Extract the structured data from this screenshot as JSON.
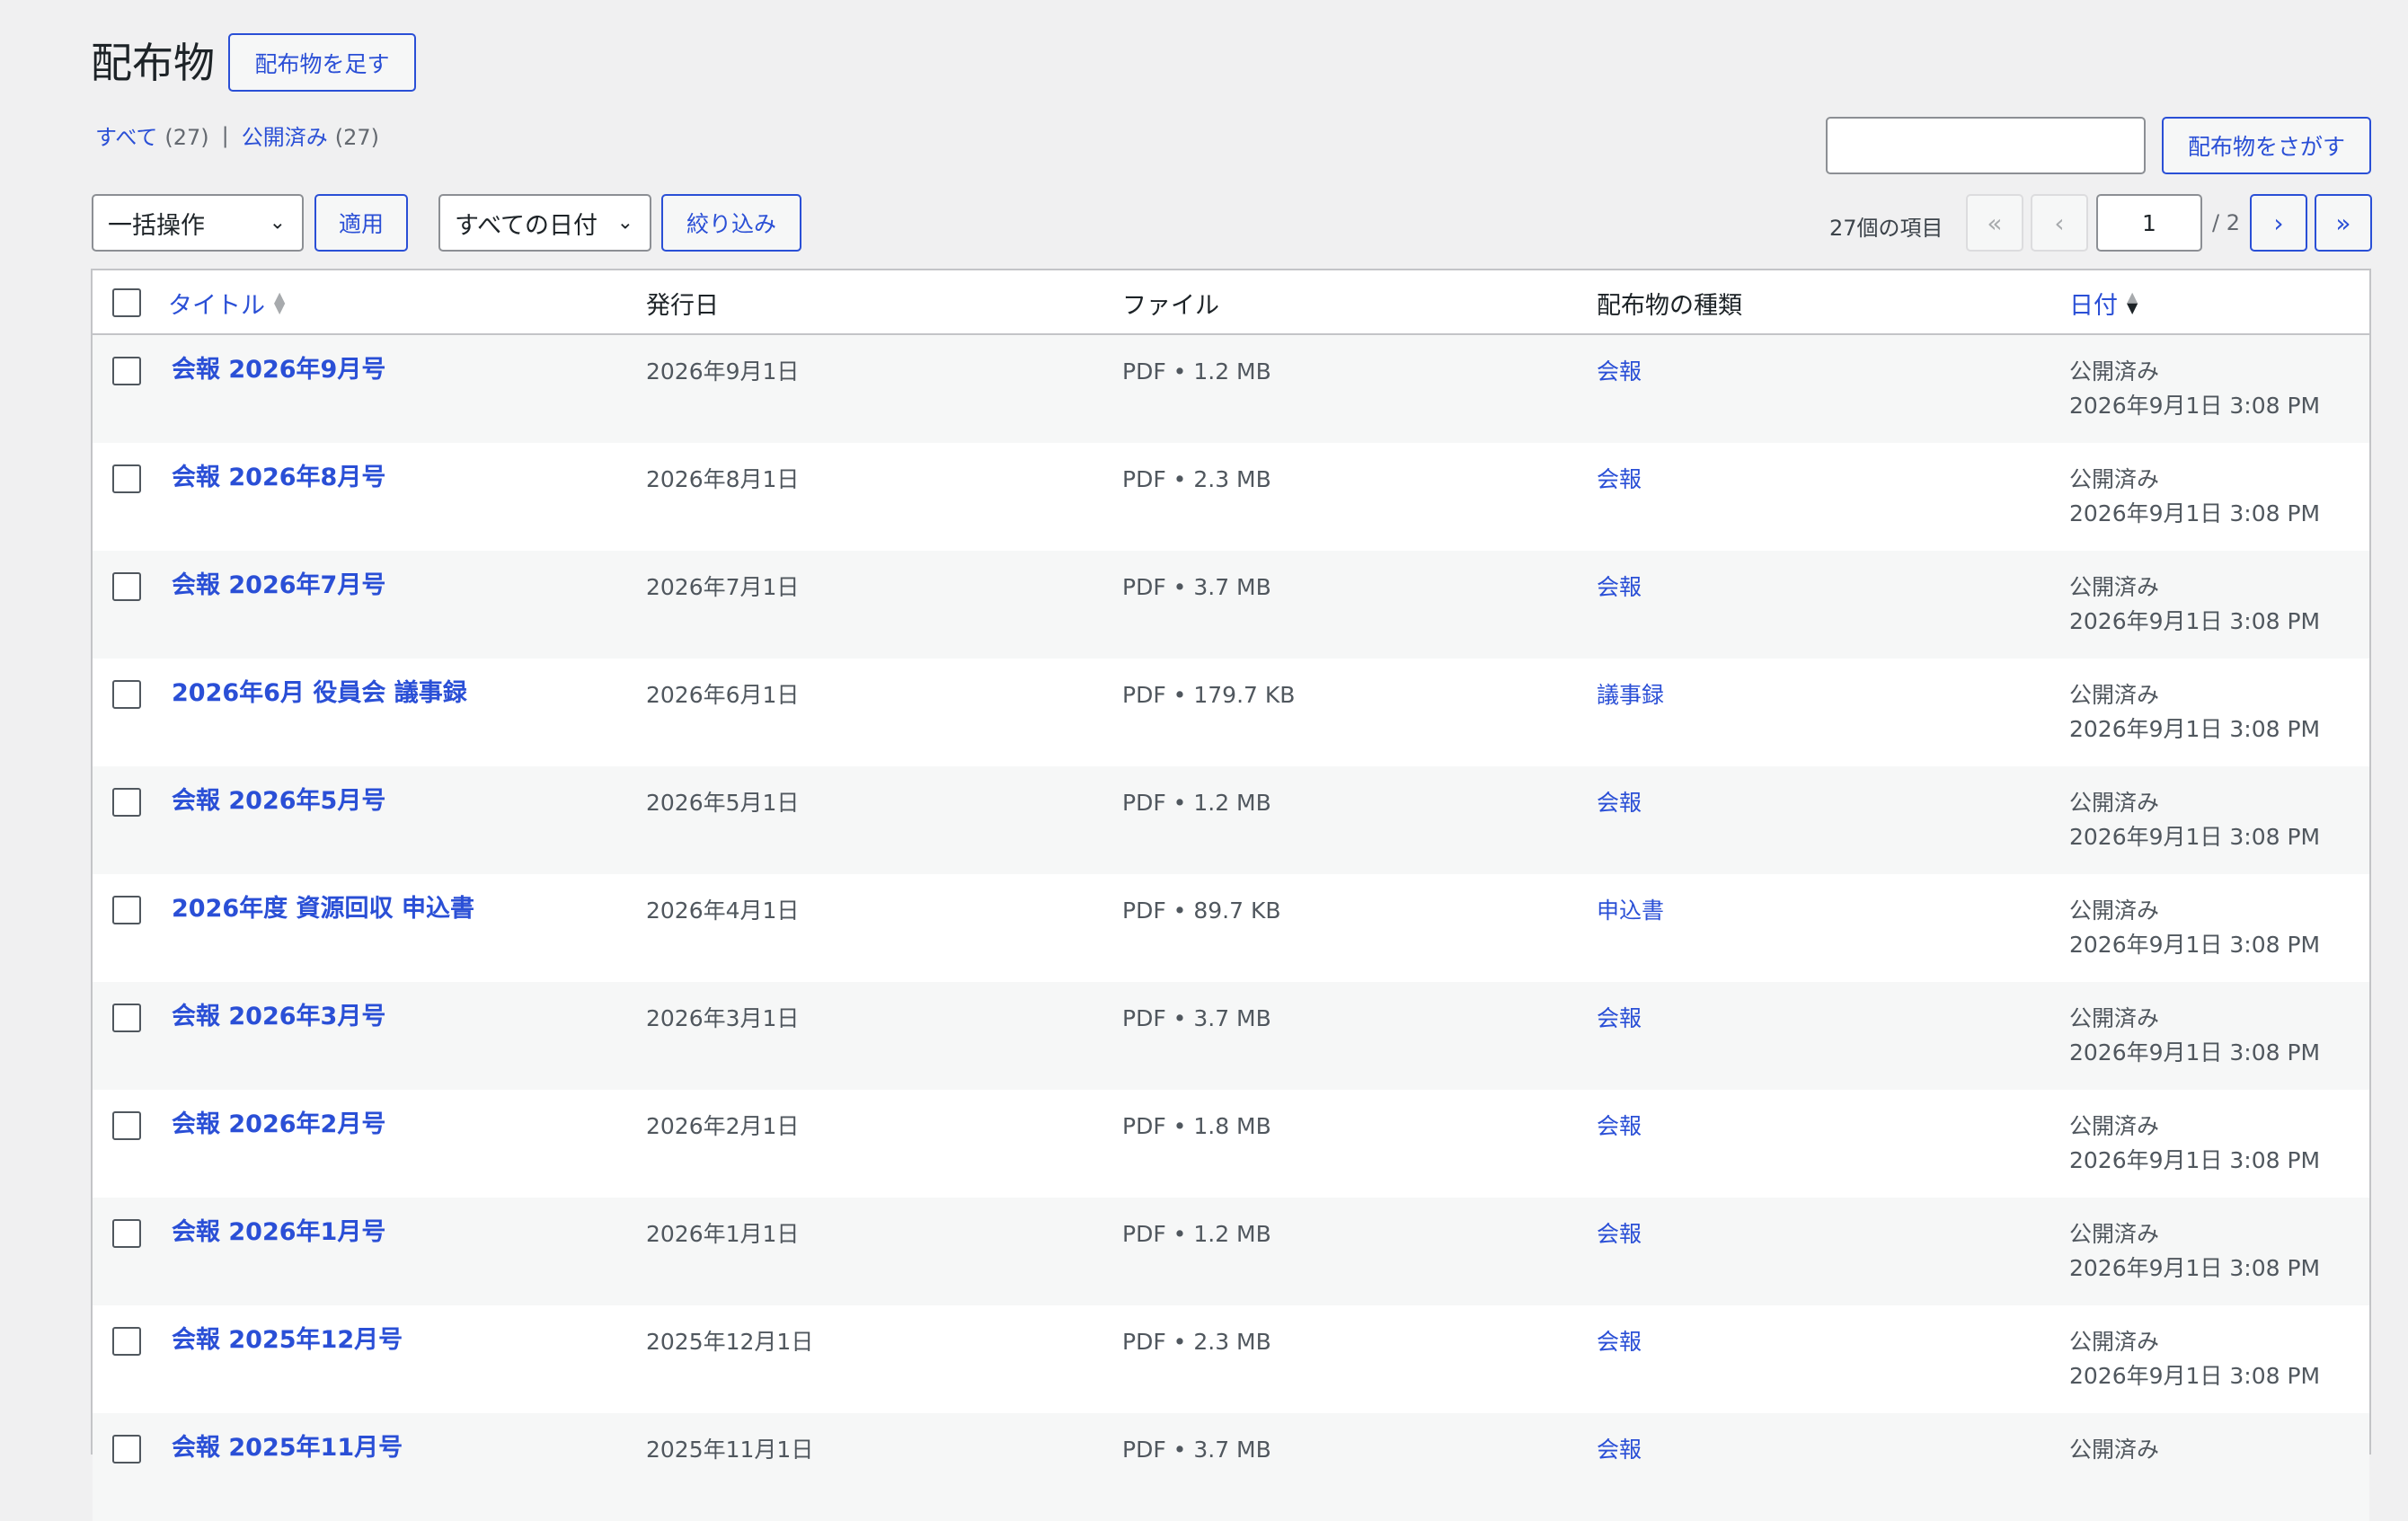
{
  "header": {
    "title": "配布物",
    "add_button": "配布物を足す"
  },
  "views": {
    "all_label": "すべて",
    "all_count": "(27)",
    "separator": "|",
    "published_label": "公開済み",
    "published_count": "(27)"
  },
  "search": {
    "value": "",
    "button": "配布物をさがす"
  },
  "tablenav": {
    "bulk_action": "一括操作",
    "apply_button": "適用",
    "date_filter": "すべての日付",
    "filter_button": "絞り込み",
    "items_count": "27個の項目",
    "first": "«",
    "prev": "‹",
    "current_page": "1",
    "total_pages": "/ 2",
    "next": "›",
    "last": "»"
  },
  "columns": {
    "title": "タイトル",
    "issue_date": "発行日",
    "file": "ファイル",
    "type": "配布物の種類",
    "date": "日付"
  },
  "rows": [
    {
      "title": "会報 2026年9月号",
      "issue_date": "2026年9月1日",
      "file": "PDF • 1.2 MB",
      "type": "会報",
      "status": "公開済み",
      "datetime": "2026年9月1日 3:08 PM"
    },
    {
      "title": "会報 2026年8月号",
      "issue_date": "2026年8月1日",
      "file": "PDF • 2.3 MB",
      "type": "会報",
      "status": "公開済み",
      "datetime": "2026年9月1日 3:08 PM"
    },
    {
      "title": "会報 2026年7月号",
      "issue_date": "2026年7月1日",
      "file": "PDF • 3.7 MB",
      "type": "会報",
      "status": "公開済み",
      "datetime": "2026年9月1日 3:08 PM"
    },
    {
      "title": "2026年6月 役員会 議事録",
      "issue_date": "2026年6月1日",
      "file": "PDF • 179.7 KB",
      "type": "議事録",
      "status": "公開済み",
      "datetime": "2026年9月1日 3:08 PM"
    },
    {
      "title": "会報 2026年5月号",
      "issue_date": "2026年5月1日",
      "file": "PDF • 1.2 MB",
      "type": "会報",
      "status": "公開済み",
      "datetime": "2026年9月1日 3:08 PM"
    },
    {
      "title": "2026年度 資源回収 申込書",
      "issue_date": "2026年4月1日",
      "file": "PDF • 89.7 KB",
      "type": "申込書",
      "status": "公開済み",
      "datetime": "2026年9月1日 3:08 PM"
    },
    {
      "title": "会報 2026年3月号",
      "issue_date": "2026年3月1日",
      "file": "PDF • 3.7 MB",
      "type": "会報",
      "status": "公開済み",
      "datetime": "2026年9月1日 3:08 PM"
    },
    {
      "title": "会報 2026年2月号",
      "issue_date": "2026年2月1日",
      "file": "PDF • 1.8 MB",
      "type": "会報",
      "status": "公開済み",
      "datetime": "2026年9月1日 3:08 PM"
    },
    {
      "title": "会報 2026年1月号",
      "issue_date": "2026年1月1日",
      "file": "PDF • 1.2 MB",
      "type": "会報",
      "status": "公開済み",
      "datetime": "2026年9月1日 3:08 PM"
    },
    {
      "title": "会報 2025年12月号",
      "issue_date": "2025年12月1日",
      "file": "PDF • 2.3 MB",
      "type": "会報",
      "status": "公開済み",
      "datetime": "2026年9月1日 3:08 PM"
    },
    {
      "title": "会報 2025年11月号",
      "issue_date": "2025年11月1日",
      "file": "PDF • 3.7 MB",
      "type": "会報",
      "status": "公開済み",
      "datetime": ""
    }
  ]
}
